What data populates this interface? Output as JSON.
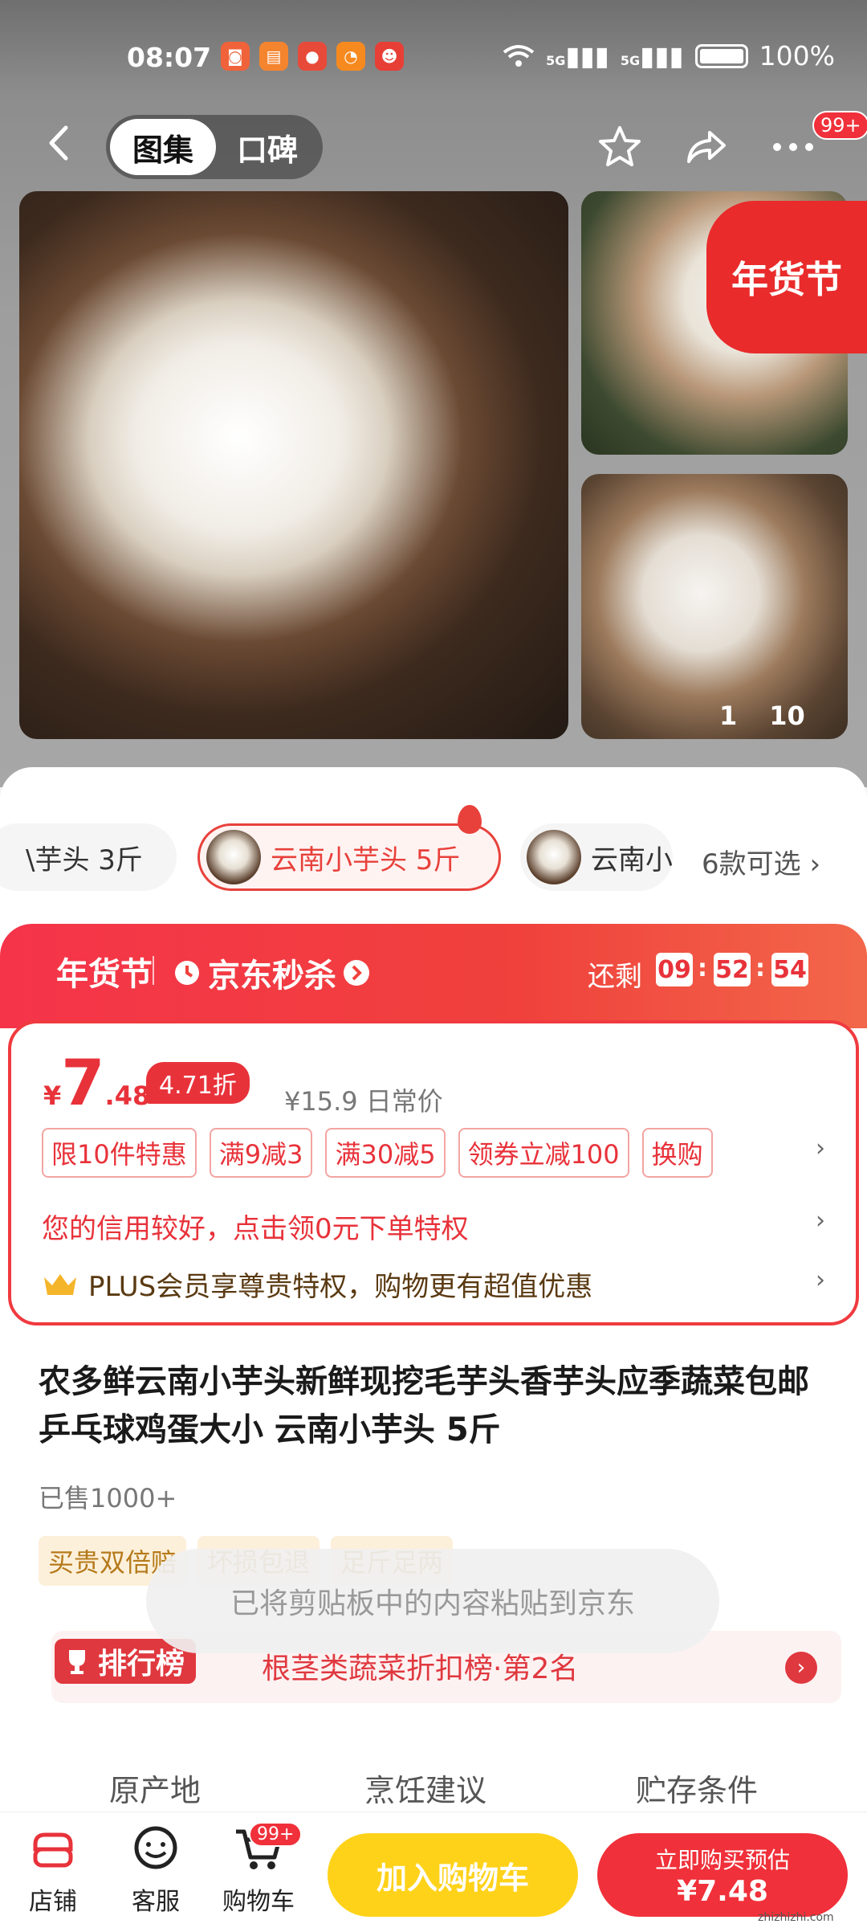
{
  "status": {
    "time": "08:07",
    "battery": "100%",
    "signal1": "5G",
    "signal2": "5G"
  },
  "nav": {
    "tab_gallery": "图集",
    "tab_reviews": "口碑",
    "badge": "99+"
  },
  "gallery": {
    "promo_tag": "年货节",
    "counter_current": "1",
    "counter_total": "10"
  },
  "variants": {
    "items": [
      "\\芋头 3斤",
      "云南小芋头 5斤",
      "云南小"
    ],
    "selected_index": 1,
    "more": "6款可选"
  },
  "promo": {
    "festival": "年货节",
    "jd_seckill": "京东秒杀",
    "remain_label": "还剩",
    "countdown": [
      "09",
      "52",
      "54"
    ],
    "price_symbol": "¥",
    "price_int": "7",
    "price_dec": ".48",
    "discount": "4.71折",
    "original": "¥15.9 日常价",
    "chips": [
      "限10件特惠",
      "满9减3",
      "满30减5",
      "领券立减100",
      "换购"
    ],
    "credit_text": "您的信用较好，点击领0元下单特权",
    "plus_text": "PLUS会员享尊贵特权，购物更有超值优惠"
  },
  "product": {
    "title": "农多鲜云南小芋头新鲜现挖毛芋头香芋头应季蔬菜包邮乒乓球鸡蛋大小 云南小芋头 5斤",
    "sold": "已售1000+",
    "tags": [
      "买贵双倍赔",
      "坏损包退",
      "足斤足两"
    ]
  },
  "toast": "已将剪贴板中的内容粘贴到京东",
  "ranking": {
    "tag": "排行榜",
    "text": "根茎类蔬菜折扣榜·第2名"
  },
  "specs": [
    "原产地",
    "烹饪建议",
    "贮存条件"
  ],
  "bottom": {
    "shop": "店铺",
    "service": "客服",
    "cart": "购物车",
    "cart_badge": "99+",
    "add_cart": "加入购物车",
    "buy_line1": "立即购买预估",
    "buy_line2": "¥7.48"
  },
  "watermark": "zhizhizhi.com",
  "colors": {
    "accent_red": "#f0303a",
    "cart_yellow": "#ffd21a"
  }
}
